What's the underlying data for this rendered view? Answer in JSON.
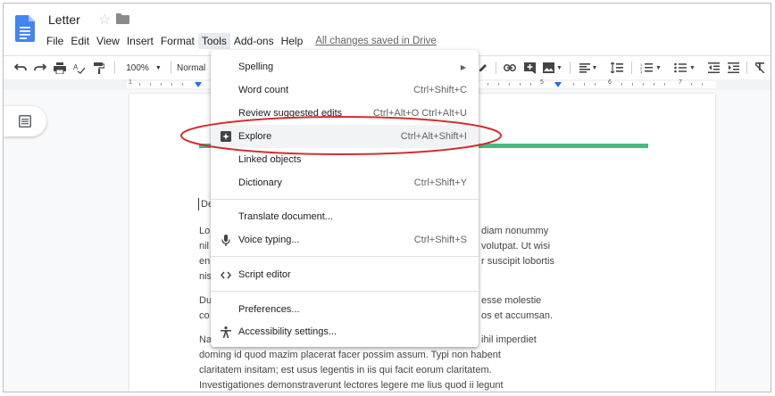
{
  "app": {
    "doc_title": "Letter",
    "saved_status": "All changes saved in Drive"
  },
  "menubar": {
    "items": [
      "File",
      "Edit",
      "View",
      "Insert",
      "Format",
      "Tools",
      "Add-ons",
      "Help"
    ],
    "active": "Tools"
  },
  "toolbar": {
    "zoom": "100%",
    "style": "Normal"
  },
  "ruler": {
    "numbers": [
      "1",
      "5",
      "6",
      "7"
    ]
  },
  "document": {
    "salutation_fragment": "De",
    "paragraphs": [
      [
        "Lo",
        "nil",
        "en",
        "nis"
      ],
      [
        "Du",
        "co"
      ],
      [
        "Na",
        "doming id quod mazim placerat facer possim assum. Typi non habent",
        "claritatem insitam; est usus legentis in iis qui facit eorum claritatem.",
        "Investigationes demonstraverunt lectores legere me lius quod ii legunt"
      ]
    ],
    "right_fragments_p1": [
      "diam nonummy",
      "volutpat. Ut wisi",
      "r suscipit lobortis"
    ],
    "right_fragments_p2": [
      "esse molestie",
      "os et accumsan."
    ],
    "right_fragments_p3": [
      "ihil imperdiet"
    ]
  },
  "tools_menu": {
    "items": [
      {
        "label": "Spelling",
        "shortcut": "",
        "icon": "",
        "submenu": true
      },
      {
        "label": "Word count",
        "shortcut": "Ctrl+Shift+C",
        "icon": ""
      },
      {
        "label": "Review suggested edits",
        "shortcut": "Ctrl+Alt+O Ctrl+Alt+U",
        "icon": ""
      },
      {
        "label": "Explore",
        "shortcut": "Ctrl+Alt+Shift+I",
        "icon": "explore-icon",
        "highlighted": true
      },
      {
        "label": "Linked objects",
        "shortcut": "",
        "icon": ""
      },
      {
        "label": "Dictionary",
        "shortcut": "Ctrl+Shift+Y",
        "icon": ""
      },
      {
        "label": "Translate document...",
        "shortcut": "",
        "icon": ""
      },
      {
        "label": "Voice typing...",
        "shortcut": "Ctrl+Shift+S",
        "icon": "microphone-icon"
      },
      {
        "label": "Script editor",
        "shortcut": "",
        "icon": "code-icon"
      },
      {
        "label": "Preferences...",
        "shortcut": "",
        "icon": ""
      },
      {
        "label": "Accessibility settings...",
        "shortcut": "",
        "icon": "accessibility-icon"
      }
    ]
  },
  "colors": {
    "annotation_ellipse": "#d32f2f",
    "accent_bar": "#4cb782",
    "docs_blue": "#4285f4",
    "ruler_marker": "#1a73e8"
  }
}
